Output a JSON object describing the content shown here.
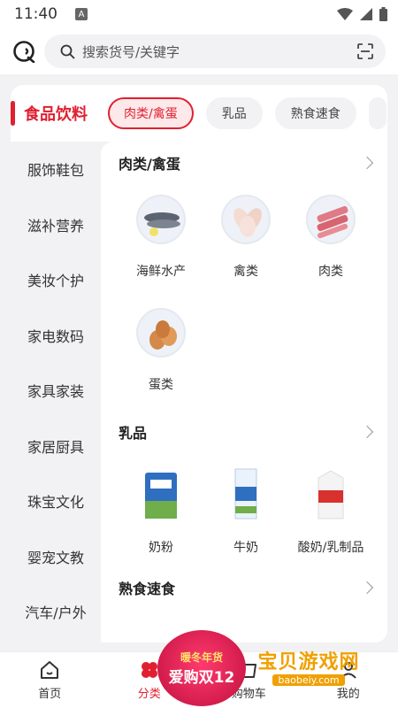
{
  "status_bar": {
    "time": "11:40",
    "notification_icon": "A"
  },
  "search": {
    "placeholder": "搜索货号/关键字"
  },
  "sidebar": {
    "items": [
      {
        "label": "食品饮料",
        "active": true
      },
      {
        "label": "服饰鞋包"
      },
      {
        "label": "滋补营养"
      },
      {
        "label": "美妆个护"
      },
      {
        "label": "家电数码"
      },
      {
        "label": "家具家装"
      },
      {
        "label": "家居厨具"
      },
      {
        "label": "珠宝文化"
      },
      {
        "label": "婴宠文教"
      },
      {
        "label": "汽车/户外"
      }
    ]
  },
  "tabs": [
    {
      "label": "肉类/禽蛋",
      "active": true
    },
    {
      "label": "乳品"
    },
    {
      "label": "熟食速食"
    }
  ],
  "sections": [
    {
      "title": "肉类/禽蛋",
      "items": [
        "海鲜水产",
        "禽类",
        "肉类",
        "蛋类"
      ]
    },
    {
      "title": "乳品",
      "items": [
        "奶粉",
        "牛奶",
        "酸奶/乳制品"
      ]
    },
    {
      "title": "熟食速食",
      "items": []
    }
  ],
  "bottom_nav": [
    {
      "label": "首页",
      "icon": "home-icon"
    },
    {
      "label": "分类",
      "icon": "category-icon",
      "active": true
    },
    {
      "label": "购物车",
      "icon": "cart-icon"
    },
    {
      "label": "我的",
      "icon": "profile-icon"
    }
  ],
  "promo": {
    "line1": "暖冬年货",
    "line2": "爱购双12"
  },
  "watermark": {
    "title": "宝贝游戏网",
    "url": "baobeiy.com"
  },
  "colors": {
    "accent": "#e02030",
    "background": "#f2f2f4"
  }
}
